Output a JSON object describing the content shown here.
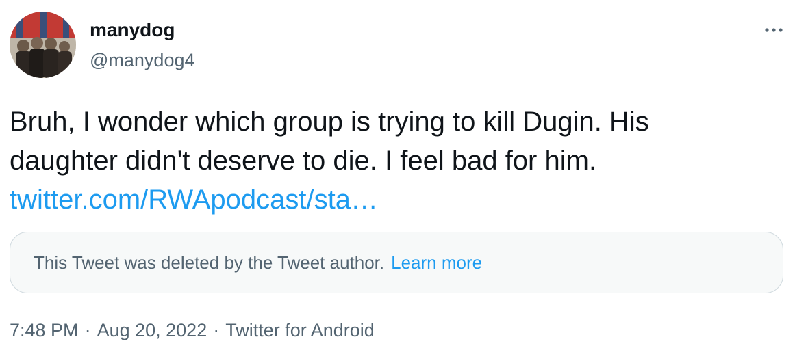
{
  "author": {
    "display_name": "manydog",
    "handle": "@manydog4"
  },
  "tweet": {
    "text_line1": "Bruh, I wonder which group is trying to kill Dugin. His",
    "text_line2": "daughter didn't deserve to die. I feel bad for him.",
    "link_text": "twitter.com/RWApodcast/sta…"
  },
  "quoted_deleted": {
    "message": "This Tweet was deleted by the Tweet author.",
    "learn_more": "Learn more"
  },
  "meta": {
    "time": "7:48 PM",
    "separator": "·",
    "date": "Aug 20, 2022",
    "source": "Twitter for Android"
  },
  "icons": {
    "more": "more-horizontal-icon",
    "avatar": "avatar-image"
  },
  "colors": {
    "link": "#1d9bf0",
    "secondary_text": "#536471",
    "primary_text": "#0f1419",
    "box_bg": "#f7f9f9",
    "box_border": "#cfd9de"
  }
}
